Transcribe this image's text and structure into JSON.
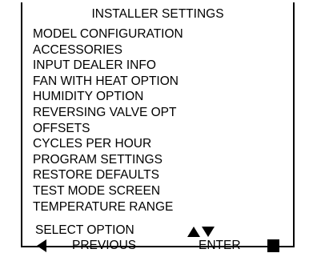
{
  "title": "INSTALLER SETTINGS",
  "menu": [
    "MODEL CONFIGURATION",
    "ACCESSORIES",
    "INPUT DEALER INFO",
    "FAN WITH HEAT OPTION",
    "HUMIDITY OPTION",
    "REVERSING VALVE OPT",
    "OFFSETS",
    "CYCLES PER HOUR",
    "PROGRAM SETTINGS",
    "RESTORE DEFAULTS",
    "TEST MODE SCREEN",
    "TEMPERATURE RANGE"
  ],
  "footer": {
    "select_label": "SELECT OPTION",
    "previous_label": "PREVIOUS",
    "enter_label": "ENTER"
  },
  "icons": {
    "up": "triangle-up-icon",
    "down": "triangle-down-icon",
    "left": "triangle-left-icon",
    "enter": "square-icon"
  },
  "colors": {
    "background": "#ffffff",
    "foreground": "#000000"
  }
}
